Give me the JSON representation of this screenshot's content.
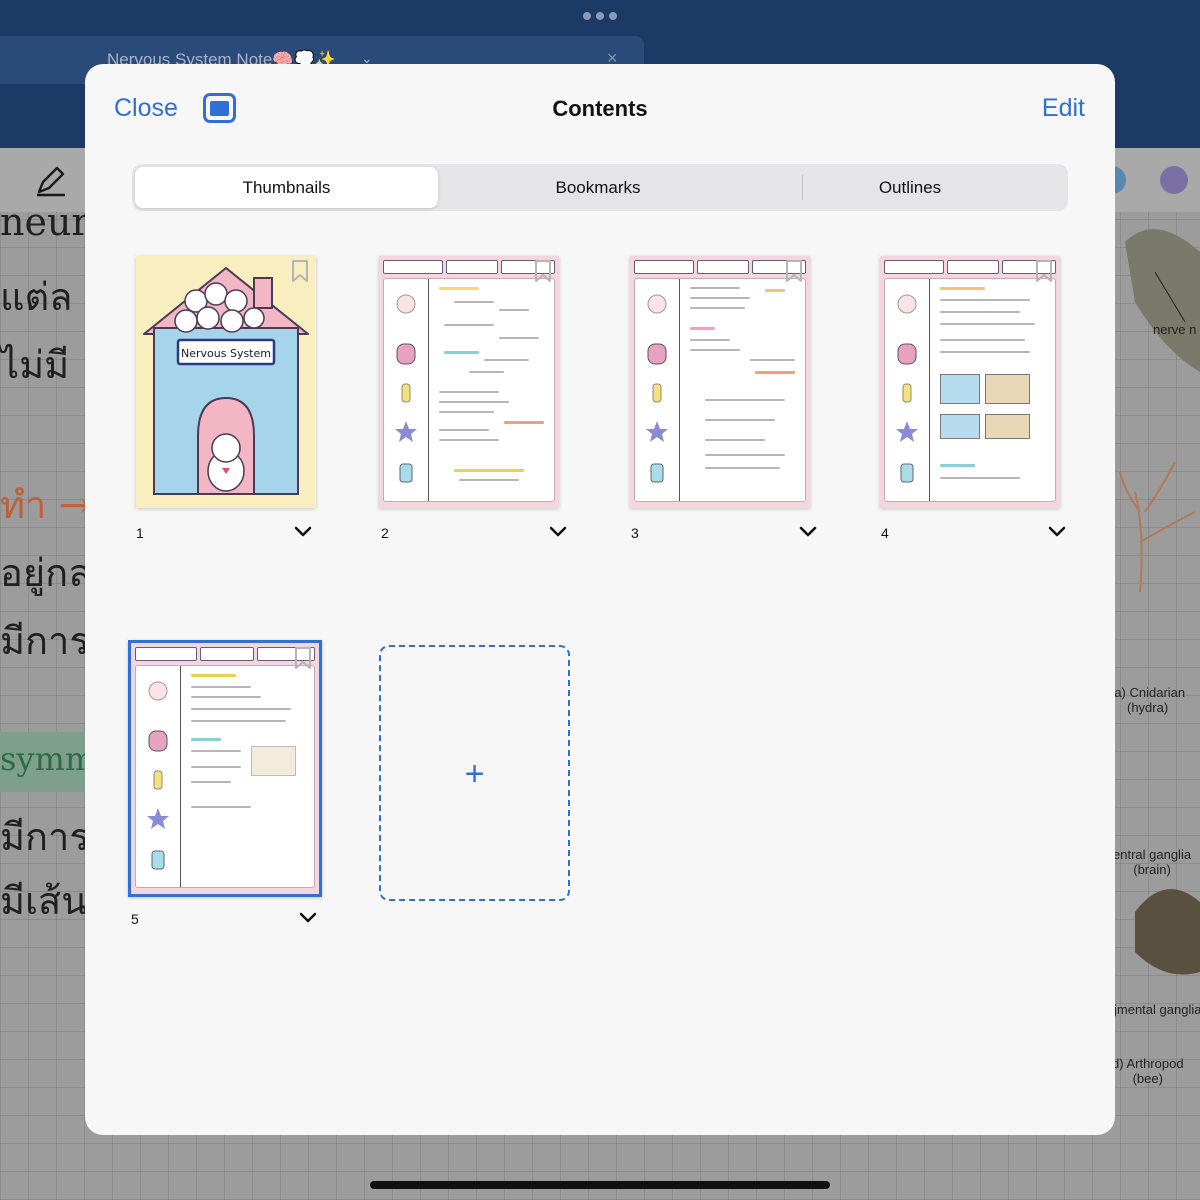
{
  "background_app": {
    "tab_title": "Nervous System Note🧠💭✨",
    "notes_lines": [
      "neur",
      "แต่ล",
      "ไม่มี",
      "ทำ →",
      "อยู่กล",
      "มีการ",
      "symme",
      "มีการ",
      "มีเส้น"
    ],
    "figure_labels": {
      "nerve": "nerve n",
      "cnidarian": "(a) Cnidarian\n(hydra)",
      "central_ganglia": "entral ganglia\n(brain)",
      "segmental_ganglia": "jmental ganglia",
      "arthropod": "d) Arthropod\n(bee)"
    },
    "swatch_colors": [
      "#5a86b6",
      "#7b6fa5"
    ]
  },
  "modal": {
    "close_label": "Close",
    "title": "Contents",
    "edit_label": "Edit",
    "tabs": [
      "Thumbnails",
      "Bookmarks",
      "Outlines"
    ],
    "selected_tab": "Thumbnails",
    "accent_color": "#2f6fd6"
  },
  "pages": [
    {
      "number": "1",
      "cover_title": "Nervous System"
    },
    {
      "number": "2"
    },
    {
      "number": "3"
    },
    {
      "number": "4"
    },
    {
      "number": "5",
      "selected": true
    }
  ],
  "add_page_label": "+"
}
